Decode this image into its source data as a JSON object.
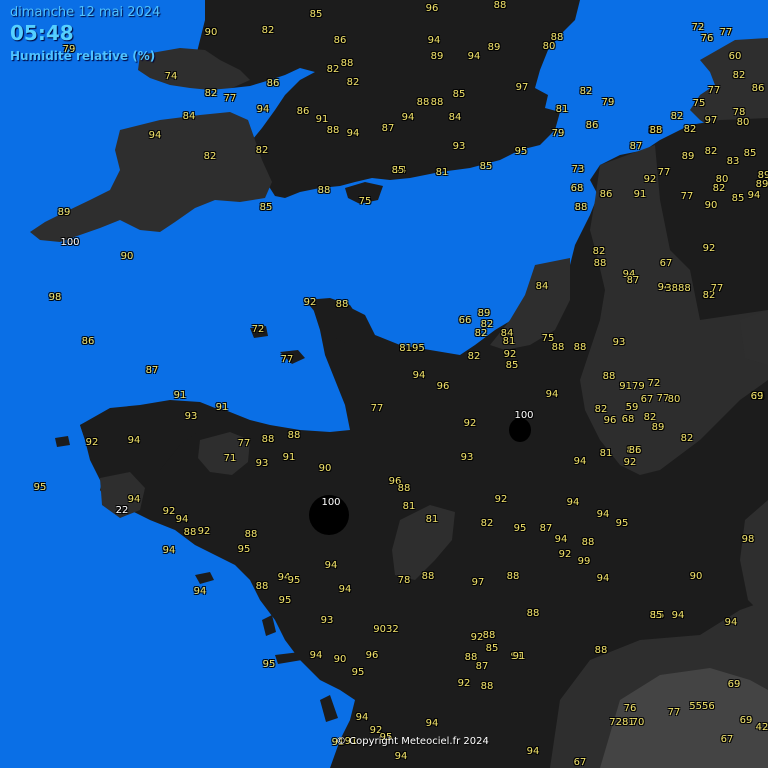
{
  "header": {
    "date": "dimanche 12 mai 2024",
    "time": "05:48",
    "parameter": "Humidité relative (%)"
  },
  "copyright": "© Copyright Meteociel.fr 2024",
  "colors": {
    "sea": "#0a6fe6",
    "land_high": "#1c1c1c",
    "land_mid": "#2e2e2e",
    "land_low": "#444444",
    "saturated": "#000000",
    "value_text": "#f2e36a",
    "header_text": "#4fc3ff"
  },
  "stations": [
    {
      "v": "85"
    },
    {
      "v": "96"
    },
    {
      "v": "88"
    },
    {
      "v": "90"
    },
    {
      "v": "82"
    },
    {
      "v": "86"
    },
    {
      "v": "94"
    },
    {
      "v": "89"
    },
    {
      "v": "88"
    },
    {
      "v": "80"
    },
    {
      "v": "72"
    },
    {
      "v": "76"
    },
    {
      "v": "77"
    },
    {
      "v": "60"
    },
    {
      "v": "79"
    },
    {
      "v": "74"
    },
    {
      "v": "82"
    },
    {
      "v": "88"
    },
    {
      "v": "82"
    },
    {
      "v": "89"
    },
    {
      "v": "94"
    },
    {
      "v": "86"
    },
    {
      "v": "82"
    },
    {
      "v": "77"
    },
    {
      "v": "94"
    },
    {
      "v": "86"
    },
    {
      "v": "91"
    },
    {
      "v": "88"
    },
    {
      "v": "94"
    },
    {
      "v": "87"
    },
    {
      "v": "94"
    },
    {
      "v": "88"
    },
    {
      "v": "88"
    },
    {
      "v": "85"
    },
    {
      "v": "84"
    },
    {
      "v": "97"
    },
    {
      "v": "82"
    },
    {
      "v": "79"
    },
    {
      "v": "81"
    },
    {
      "v": "75"
    },
    {
      "v": "77"
    },
    {
      "v": "82"
    },
    {
      "v": "86"
    },
    {
      "v": "84"
    },
    {
      "v": "82"
    },
    {
      "v": "97"
    },
    {
      "v": "94"
    },
    {
      "v": "79"
    },
    {
      "v": "86"
    },
    {
      "v": "88"
    },
    {
      "v": "87"
    },
    {
      "v": "82"
    },
    {
      "v": "78"
    },
    {
      "v": "80"
    },
    {
      "v": "89"
    },
    {
      "v": "82"
    },
    {
      "v": "83"
    },
    {
      "v": "85"
    },
    {
      "v": "85"
    },
    {
      "v": "81"
    },
    {
      "v": "94"
    },
    {
      "v": "95"
    },
    {
      "v": "93"
    },
    {
      "v": "73"
    },
    {
      "v": "77"
    },
    {
      "v": "92"
    },
    {
      "v": "80"
    },
    {
      "v": "89"
    },
    {
      "v": "82"
    },
    {
      "v": "88"
    },
    {
      "v": "85"
    },
    {
      "v": "75"
    },
    {
      "v": "68"
    },
    {
      "v": "86"
    },
    {
      "v": "91"
    },
    {
      "v": "77"
    },
    {
      "v": "82"
    },
    {
      "v": "85"
    },
    {
      "v": "94"
    },
    {
      "v": "89"
    },
    {
      "v": "82"
    },
    {
      "v": "100",
      "w": true
    },
    {
      "v": "85"
    },
    {
      "v": "89"
    },
    {
      "v": "88"
    },
    {
      "v": "90"
    },
    {
      "v": "88"
    },
    {
      "v": "90"
    },
    {
      "v": "67"
    },
    {
      "v": "92"
    },
    {
      "v": "82"
    },
    {
      "v": "88"
    },
    {
      "v": "94"
    },
    {
      "v": "87"
    },
    {
      "v": "94"
    },
    {
      "v": "3888"
    },
    {
      "v": "82"
    },
    {
      "v": "77"
    },
    {
      "v": "84"
    },
    {
      "v": "98"
    },
    {
      "v": "92"
    },
    {
      "v": "88"
    },
    {
      "v": "89"
    },
    {
      "v": "66"
    },
    {
      "v": "82"
    },
    {
      "v": "84"
    },
    {
      "v": "82"
    },
    {
      "v": "81"
    },
    {
      "v": "75"
    },
    {
      "v": "88"
    },
    {
      "v": "88"
    },
    {
      "v": "93"
    },
    {
      "v": "86"
    },
    {
      "v": "72"
    },
    {
      "v": "77"
    },
    {
      "v": "8195"
    },
    {
      "v": "82"
    },
    {
      "v": "92"
    },
    {
      "v": "85"
    },
    {
      "v": "87"
    },
    {
      "v": "94"
    },
    {
      "v": "96"
    },
    {
      "v": "88"
    },
    {
      "v": "72"
    },
    {
      "v": "9179"
    },
    {
      "v": "77"
    },
    {
      "v": "80"
    },
    {
      "v": "83"
    },
    {
      "v": "91"
    },
    {
      "v": "94"
    },
    {
      "v": "69"
    },
    {
      "v": "93"
    },
    {
      "v": "91"
    },
    {
      "v": "77"
    },
    {
      "v": "100",
      "w": true
    },
    {
      "v": "82"
    },
    {
      "v": "59"
    },
    {
      "v": "67"
    },
    {
      "v": "92"
    },
    {
      "v": "92"
    },
    {
      "v": "96"
    },
    {
      "v": "68"
    },
    {
      "v": "82"
    },
    {
      "v": "94"
    },
    {
      "v": "77"
    },
    {
      "v": "88"
    },
    {
      "v": "88"
    },
    {
      "v": "89"
    },
    {
      "v": "86"
    },
    {
      "v": "82"
    },
    {
      "v": "71"
    },
    {
      "v": "93"
    },
    {
      "v": "91"
    },
    {
      "v": "93"
    },
    {
      "v": "81"
    },
    {
      "v": "86"
    },
    {
      "v": "94"
    },
    {
      "v": "92"
    },
    {
      "v": "95"
    },
    {
      "v": "90"
    },
    {
      "v": "96"
    },
    {
      "v": "88"
    },
    {
      "v": "94"
    },
    {
      "v": "100",
      "w": true
    },
    {
      "v": "81"
    },
    {
      "v": "92"
    },
    {
      "v": "94"
    },
    {
      "v": "81"
    },
    {
      "v": "22",
      "w": true
    },
    {
      "v": "92"
    },
    {
      "v": "94"
    },
    {
      "v": "88"
    },
    {
      "v": "82"
    },
    {
      "v": "95"
    },
    {
      "v": "87"
    },
    {
      "v": "94"
    },
    {
      "v": "94"
    },
    {
      "v": "95"
    },
    {
      "v": "92"
    },
    {
      "v": "88"
    },
    {
      "v": "88"
    },
    {
      "v": "92"
    },
    {
      "v": "99"
    },
    {
      "v": "98"
    },
    {
      "v": "94"
    },
    {
      "v": "95"
    },
    {
      "v": "94"
    },
    {
      "v": "78"
    },
    {
      "v": "88"
    },
    {
      "v": "97"
    },
    {
      "v": "88"
    },
    {
      "v": "94"
    },
    {
      "v": "94"
    },
    {
      "v": "88"
    },
    {
      "v": "95"
    },
    {
      "v": "94"
    },
    {
      "v": "90"
    },
    {
      "v": "94"
    },
    {
      "v": "88"
    },
    {
      "v": "95"
    },
    {
      "v": "85"
    },
    {
      "v": "94"
    },
    {
      "v": "94"
    },
    {
      "v": "93"
    },
    {
      "v": "9032"
    },
    {
      "v": "92"
    },
    {
      "v": "88"
    },
    {
      "v": "85"
    },
    {
      "v": "91"
    },
    {
      "v": "91"
    },
    {
      "v": "90"
    },
    {
      "v": "96"
    },
    {
      "v": "95"
    },
    {
      "v": "88"
    },
    {
      "v": "87"
    },
    {
      "v": "88"
    },
    {
      "v": "95"
    },
    {
      "v": "94"
    },
    {
      "v": "92"
    },
    {
      "v": "88"
    },
    {
      "v": "69"
    },
    {
      "v": "76"
    },
    {
      "v": "7281"
    },
    {
      "v": "70"
    },
    {
      "v": "77"
    },
    {
      "v": "5556"
    },
    {
      "v": "69"
    },
    {
      "v": "42"
    },
    {
      "v": "94"
    },
    {
      "v": "91"
    },
    {
      "v": "92"
    },
    {
      "v": "95"
    },
    {
      "v": "94"
    },
    {
      "v": "91"
    },
    {
      "v": "94"
    },
    {
      "v": "67"
    },
    {
      "v": "94"
    },
    {
      "v": "67"
    },
    {
      "v": "85"
    }
  ]
}
